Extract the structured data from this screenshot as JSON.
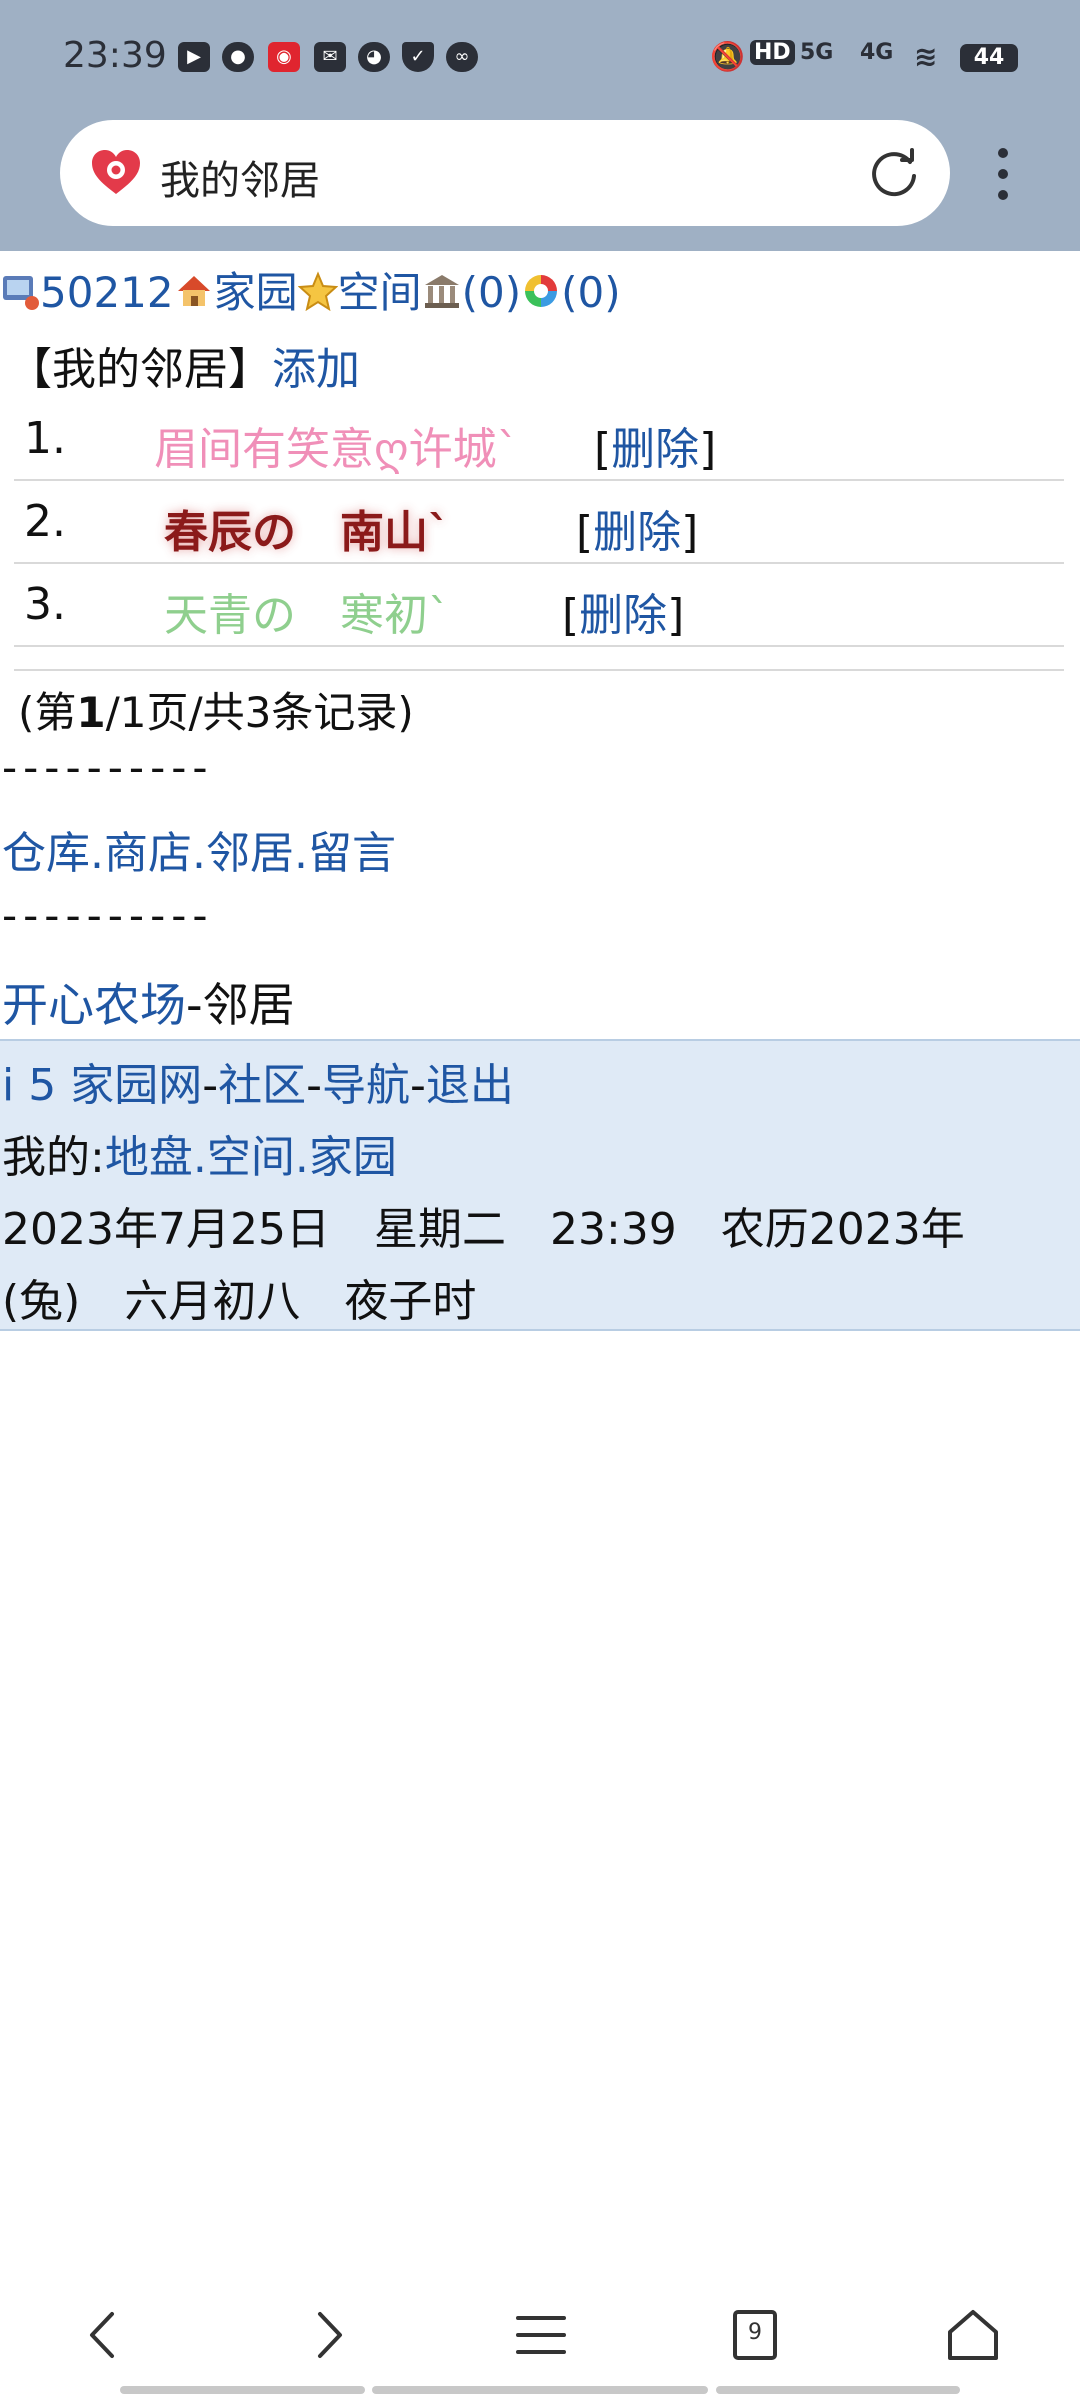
{
  "status_bar": {
    "time": "23:39",
    "network": "5G",
    "network2": "4G",
    "battery": "44"
  },
  "browser": {
    "tab_title": "我的邻居"
  },
  "header_links": {
    "user_id": "50212",
    "home": "家园",
    "space": "空间",
    "count1": "(0)",
    "count2": "(0)"
  },
  "section": {
    "title": "【我的邻居】",
    "add_label": "添加"
  },
  "neighbors": [
    {
      "index": "1.",
      "name": "眉间有笑意ღ许城ˋ",
      "delete": "删除"
    },
    {
      "index": "2.",
      "name": "春辰の　南山ˋ",
      "delete": "删除"
    },
    {
      "index": "3.",
      "name": "天青の　寒初ˋ",
      "delete": "删除"
    }
  ],
  "pagination": {
    "prefix": "(第",
    "current": "1",
    "suffix": "/1页/共3条记录)"
  },
  "divider": "----------",
  "quick_links": [
    "仓库",
    "商店",
    "邻居",
    "留言"
  ],
  "farm": {
    "link": "开心农场",
    "suffix": "-邻居"
  },
  "footer": {
    "nav_links": [
      "i 5 家园网",
      "社区",
      "导航",
      "退出"
    ],
    "my_prefix": "我的:",
    "my_links": [
      "地盘",
      "空间",
      "家园"
    ],
    "date_line1": "2023年7月25日　星期二　23:39　农历2023年",
    "date_line2": "(兔)　六月初八　夜子时"
  },
  "bottom_nav": {
    "tab_count": "9"
  }
}
